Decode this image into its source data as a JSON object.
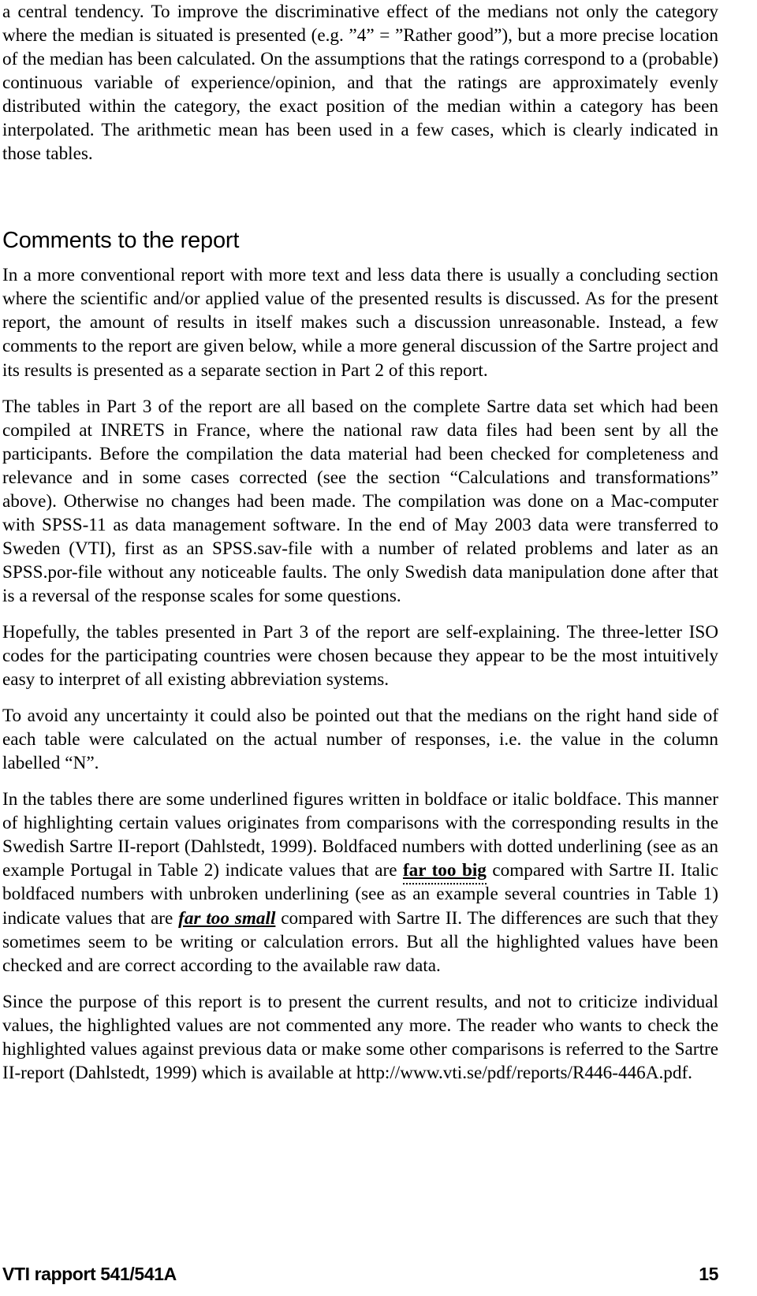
{
  "document": {
    "page_number": "15",
    "footer_label": "VTI rapport 541/541A"
  },
  "paragraphs": {
    "continued_intro": "a central tendency. To improve the discriminative effect of the medians not only the category where the median is situated is presented (e.g. ”4” = ”Rather good”), but a more precise location of the median has been calculated. On the assumptions that the ratings correspond to a (probable) continuous variable of experience/opinion, and that the ratings are approximately evenly distributed within the category, the exact position of the median within a category has been interpolated. The arithmetic mean has been used in a few cases, which is clearly indicated in those tables.",
    "p1": "In a more conventional report with more text and less data there is usually a concluding section where the scientific and/or applied value of the presented results is discussed. As for the present report, the amount of results in itself makes such a discussion unreasonable. Instead, a few comments to the report are given below, while a more general discussion of the Sartre project and its results is presented as a separate section in Part 2 of this report.",
    "p2": "The tables in Part 3 of the report are all based on the complete Sartre data set which had been compiled at INRETS in France, where the national raw data files had been sent by all the participants. Before the compilation the data material had been checked for completeness and relevance and in some cases corrected (see the section “Calculations and transformations” above). Otherwise no changes had been made. The compilation was done on a Mac-computer with SPSS-11 as data management software. In the end of May 2003 data were transferred to Sweden (VTI), first as an SPSS.sav-file with a number of related problems and later as an SPSS.por-file without any noticeable faults. The only Swedish data manipulation done after that is a reversal of the response scales for some questions.",
    "p3": "Hopefully, the tables presented in Part 3 of the report are self-explaining. The three-letter ISO codes for the participating countries were chosen because they appear to be the most intuitively easy to interpret of all existing abbreviation systems.",
    "p4": "To avoid any uncertainty it could also be pointed out that the medians on the right hand side of each table were calculated on the actual number of responses, i.e. the value in the column labelled “N”.",
    "p5_part1": "In the tables there are some underlined figures written in boldface or italic boldface. This manner of highlighting certain values originates from comparisons with the corresponding results in the Swedish Sartre II-report (Dahlstedt, 1999). Boldfaced numbers with dotted underlining (see as an example Portugal in Table 2) indicate values that are ",
    "p5_emph1": "far too big",
    "p5_part2": " compared with Sartre II. Italic boldfaced numbers with unbroken underlining (see as an example several countries in Table 1) indicate values that are ",
    "p5_emph2": "far too small",
    "p5_part3": " compared with Sartre II. The differences are such that they sometimes seem to be writing or calculation errors. But all the highlighted values have been checked and are correct according to the available raw data.",
    "p6": "Since the purpose of this report is to present the current results, and not to criticize individual values, the highlighted values are not commented any more. The reader who wants to check the highlighted values against previous data or make some other comparisons is referred to the Sartre II-report (Dahlstedt, 1999) which is available at http://www.vti.se/pdf/reports/R446-446A.pdf."
  },
  "headings": {
    "comments_to_the_report": "Comments to the report"
  }
}
